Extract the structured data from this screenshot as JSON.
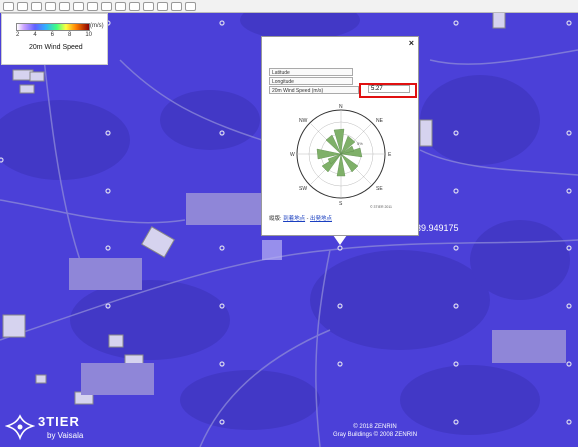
{
  "legend": {
    "unit": "(m/s)",
    "ticks": [
      "2",
      "4",
      "6",
      "8",
      "10"
    ],
    "title": "20m Wind Speed"
  },
  "popup": {
    "close": "×",
    "latitude_label": "Latitude",
    "longitude_label": "Longitude",
    "wind_label": "20m Wind Speed (m/s)",
    "wind_value": "5.27",
    "rose_labels": {
      "n": "N",
      "ne": "NE",
      "e": "E",
      "se": "SE",
      "s": "S",
      "sw": "SW",
      "w": "W",
      "nw": "NW"
    },
    "rose_percent": "5%",
    "rose_credit": "© 3TIER 2011",
    "links_prefix": "縦版:",
    "link1": "到着地点",
    "link_sep": " - ",
    "link2": "出発地点"
  },
  "map": {
    "coordinate_readout": "39.949175"
  },
  "branding": {
    "name": "3TIER",
    "sub": "by Vaisala"
  },
  "copyright": {
    "line1": "© 2018 ZENRIN",
    "line2": "Gray Buildings © 2008 ZENRIN"
  },
  "colors": {
    "map_blue": "#4a3fd6",
    "highlight": "#e01010",
    "rose_green": "#7fb069"
  }
}
